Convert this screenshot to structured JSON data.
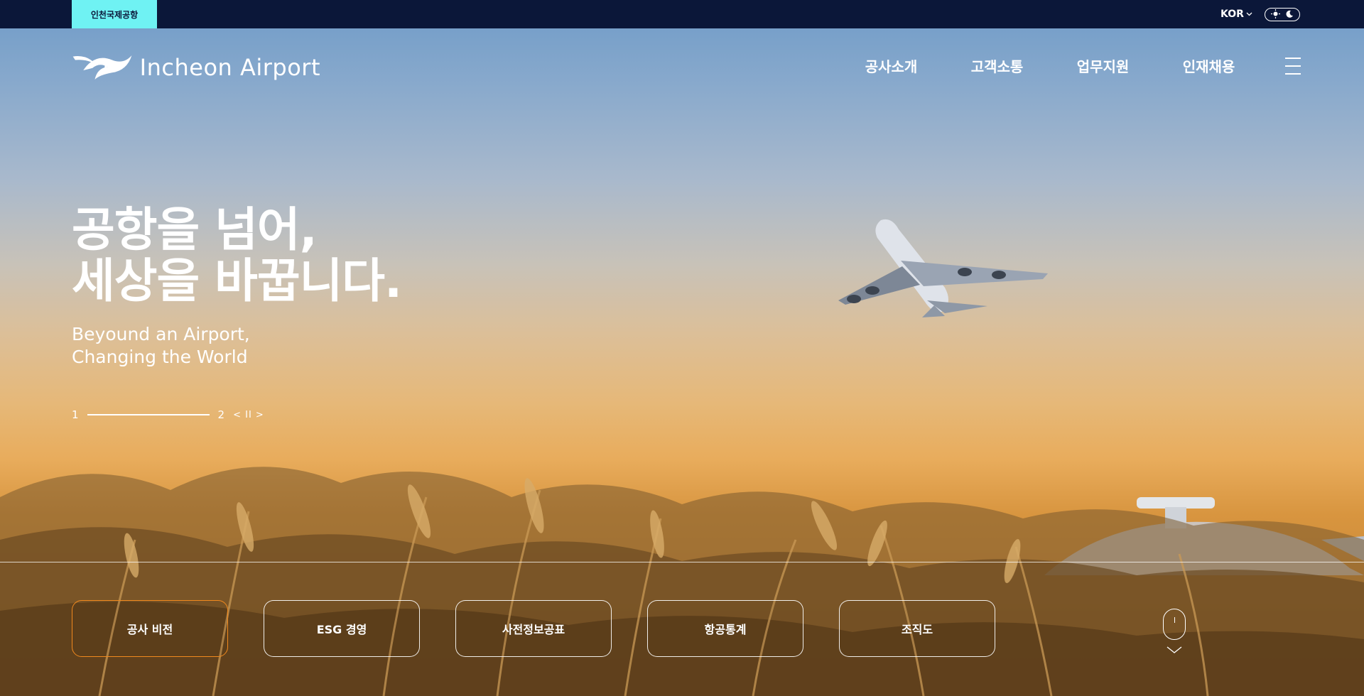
{
  "topbar": {
    "site_tab": "인천국제공항",
    "language": "KOR",
    "icons": [
      "chevron-down-icon",
      "sun-icon",
      "moon-icon"
    ]
  },
  "header": {
    "logo_text": "Incheon Airport",
    "nav": [
      {
        "label": "공사소개"
      },
      {
        "label": "고객소통"
      },
      {
        "label": "업무지원"
      },
      {
        "label": "인재채용"
      }
    ],
    "menu_icon": "hamburger-menu-icon"
  },
  "hero": {
    "title_line1": "공항을 넘어,",
    "title_line2": "세상을 바꿉니다.",
    "subtitle_line1": "Beyound an Airport,",
    "subtitle_line2": "Changing the World",
    "slider": {
      "current": "1",
      "total": "2",
      "controls": "< II >",
      "progress": 1.0
    }
  },
  "quick_links": [
    {
      "label": "공사 비전",
      "active": true
    },
    {
      "label": "ESG 경영",
      "active": false
    },
    {
      "label": "사전정보공표",
      "active": false
    },
    {
      "label": "항공통계",
      "active": false
    },
    {
      "label": "조직도",
      "active": false
    }
  ],
  "colors": {
    "topbar_bg": "#0b1739",
    "site_tab_bg": "#6ff2f3",
    "active_accent": "#f0891e"
  }
}
